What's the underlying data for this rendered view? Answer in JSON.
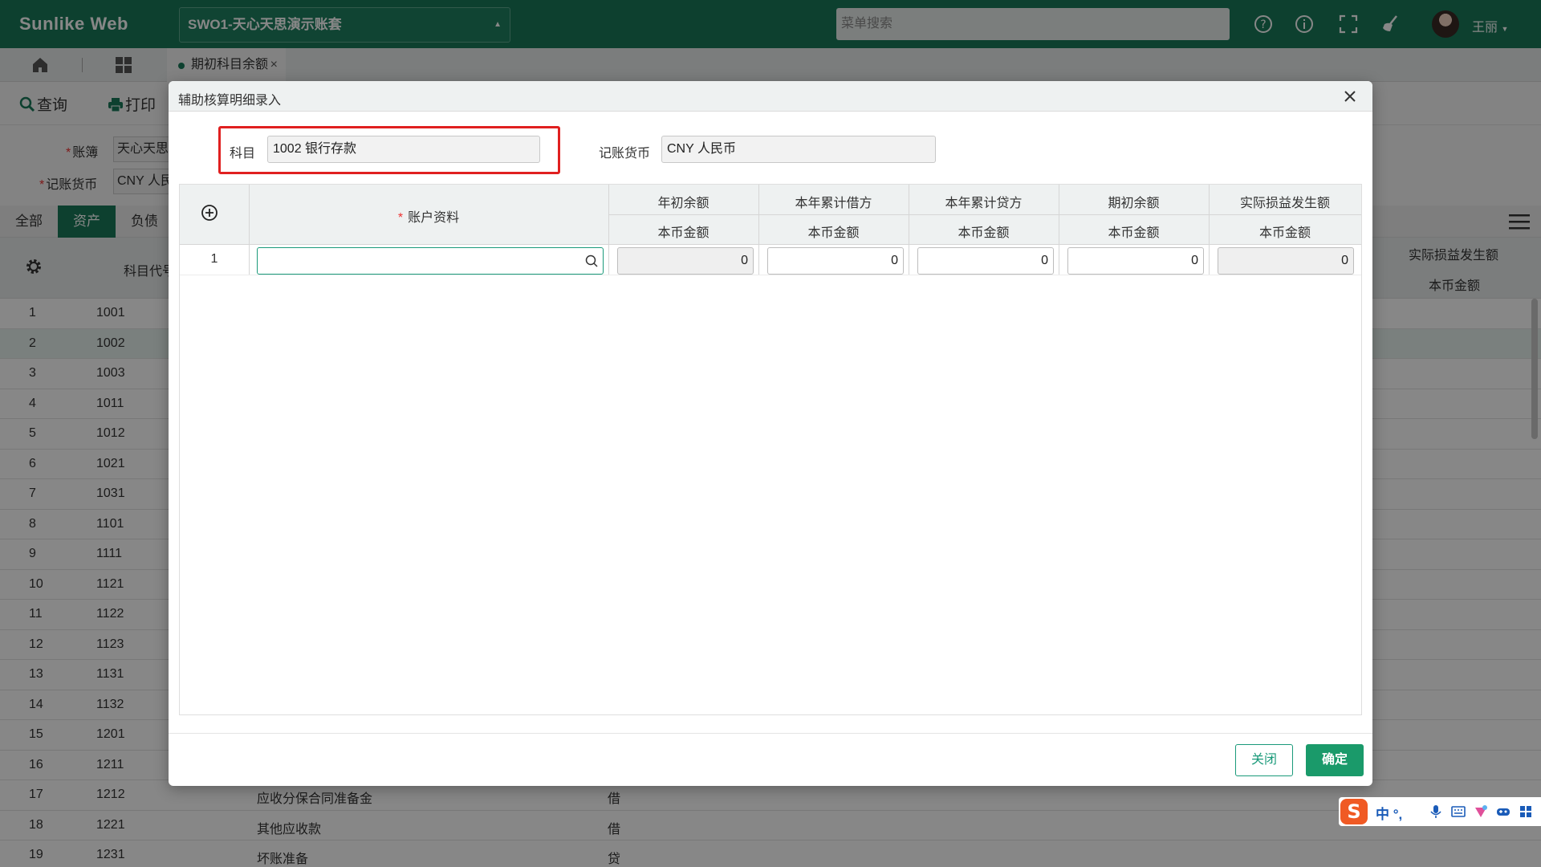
{
  "app": {
    "brand": "Sunlike Web",
    "account_set": "SWO1-天心天思演示账套",
    "menu_search_placeholder": "菜单搜索",
    "user_name": "王丽"
  },
  "tabs": {
    "open_tab": "期初科目余额"
  },
  "toolbar": {
    "query_label": "查询",
    "print_label": "打印"
  },
  "form": {
    "ledger_label": "账簿",
    "ledger_value": "天心天思",
    "currency_label": "记账货币",
    "currency_value": "CNY 人民"
  },
  "category_tabs": [
    "全部",
    "资产",
    "负债"
  ],
  "bg_table": {
    "col_code": "科目代号",
    "col_loss": "实际损益发生额",
    "col_amount": "本币金额",
    "rows": [
      {
        "n": "1",
        "code": "1001",
        "name": "",
        "dir": ""
      },
      {
        "n": "2",
        "code": "1002",
        "name": "",
        "dir": ""
      },
      {
        "n": "3",
        "code": "1003",
        "name": "",
        "dir": ""
      },
      {
        "n": "4",
        "code": "1011",
        "name": "",
        "dir": ""
      },
      {
        "n": "5",
        "code": "1012",
        "name": "",
        "dir": ""
      },
      {
        "n": "6",
        "code": "1021",
        "name": "",
        "dir": ""
      },
      {
        "n": "7",
        "code": "1031",
        "name": "",
        "dir": ""
      },
      {
        "n": "8",
        "code": "1101",
        "name": "",
        "dir": ""
      },
      {
        "n": "9",
        "code": "1111",
        "name": "",
        "dir": ""
      },
      {
        "n": "10",
        "code": "1121",
        "name": "",
        "dir": ""
      },
      {
        "n": "11",
        "code": "1122",
        "name": "",
        "dir": ""
      },
      {
        "n": "12",
        "code": "1123",
        "name": "",
        "dir": ""
      },
      {
        "n": "13",
        "code": "1131",
        "name": "",
        "dir": ""
      },
      {
        "n": "14",
        "code": "1132",
        "name": "",
        "dir": ""
      },
      {
        "n": "15",
        "code": "1201",
        "name": "",
        "dir": ""
      },
      {
        "n": "16",
        "code": "1211",
        "name": "",
        "dir": ""
      },
      {
        "n": "17",
        "code": "1212",
        "name": "应收分保合同准备金",
        "dir": "借"
      },
      {
        "n": "18",
        "code": "1221",
        "name": "其他应收款",
        "dir": "借"
      },
      {
        "n": "19",
        "code": "1231",
        "name": "坏账准备",
        "dir": "贷"
      }
    ]
  },
  "modal": {
    "title": "辅助核算明细录入",
    "subject_label": "科目",
    "subject_value": "1002 银行存款",
    "currency_label": "记账货币",
    "currency_value": "CNY 人民币",
    "grid": {
      "account_col": "账户资料",
      "columns": [
        "年初余额",
        "本年累计借方",
        "本年累计贷方",
        "期初余额",
        "实际损益发生额"
      ],
      "sub_label": "本币金额",
      "rows": [
        {
          "n": "1",
          "account": "",
          "values": [
            "0",
            "0",
            "0",
            "0",
            "0"
          ]
        }
      ]
    },
    "close_label": "关闭",
    "ok_label": "确定"
  },
  "ime": {
    "logo": "S",
    "text": "中 °,"
  },
  "colors": {
    "brand_green": "#1a7a5a",
    "button_green": "#1a9a6a",
    "highlight_red": "#e02020"
  }
}
